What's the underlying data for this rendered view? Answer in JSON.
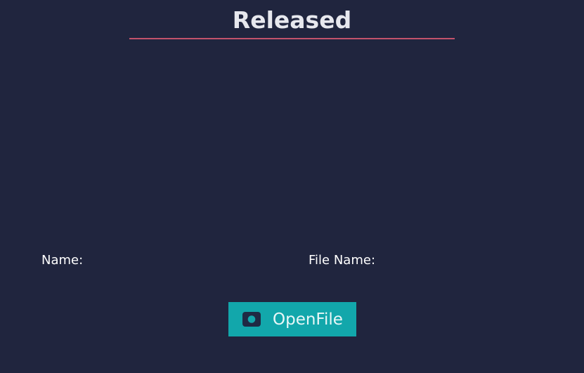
{
  "header": {
    "title": "Released"
  },
  "fields": {
    "name_label": "Name:",
    "file_name_label": "File Name:"
  },
  "open_button": {
    "label": "OpenFile",
    "icon": "record-icon"
  },
  "colors": {
    "background": "#20253e",
    "accent_underline": "#c2526b",
    "button": "#12a7ab",
    "icon_dark": "#1f2a44"
  }
}
